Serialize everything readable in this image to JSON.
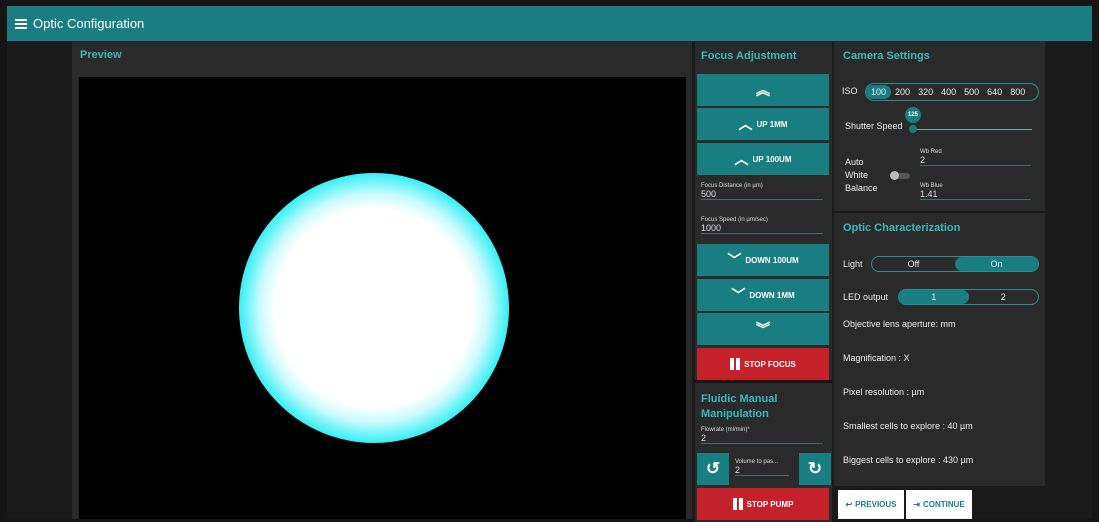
{
  "app": {
    "title": "Optic Configuration"
  },
  "preview": {
    "title": "Preview"
  },
  "focus": {
    "title": "Focus Adjustment",
    "up_1mm": "UP 1MM",
    "up_100um": "UP 100UM",
    "distance_label": "Focus Distance (in µm)",
    "distance_value": "500",
    "speed_label": "Focus Speed (in µm/sec)",
    "speed_value": "1000",
    "down_100um": "DOWN 100UM",
    "down_1mm": "DOWN 1MM",
    "stop_focus": "STOP FOCUS"
  },
  "fluidic": {
    "title": "Fluidic Manual Manipulation",
    "flowrate_label": "Flowrate (ml/min)*",
    "flowrate_value": "2",
    "volume_label": "Volume to pas...",
    "volume_value": "2",
    "stop_pump": "STOP PUMP"
  },
  "camera": {
    "title": "Camera Settings",
    "iso_label": "ISO",
    "iso_options": [
      "100",
      "200",
      "320",
      "400",
      "500",
      "640",
      "800"
    ],
    "iso_selected": "100",
    "shutter_label": "Shutter Speed",
    "shutter_value": "125",
    "awb_line1": "Auto",
    "awb_line2": "White",
    "awb_line3": "Balance",
    "wb_red_label": "Wb Red",
    "wb_red_value": "2",
    "wb_blue_label": "Wb Blue",
    "wb_blue_value": "1.41"
  },
  "optic": {
    "title": "Optic Characterization",
    "light_label": "Light",
    "light_off": "Off",
    "light_on": "On",
    "light_selected": "On",
    "led_label": "LED output",
    "led_opt1": "1",
    "led_opt2": "2",
    "led_selected": "1",
    "aperture": "Objective lens aperture: mm",
    "magnification": "Magnification : X",
    "pixel_resolution": "Pixel resolution : µm",
    "smallest": "Smallest cells to explore : 40 µm",
    "biggest": "Biggest cells to explore : 430 µm"
  },
  "nav": {
    "previous": "PREVIOUS",
    "continue": "CONTINUE"
  },
  "colors": {
    "accent": "#187e81",
    "accent_text": "#3cb7c0",
    "stop": "#c4212a"
  }
}
